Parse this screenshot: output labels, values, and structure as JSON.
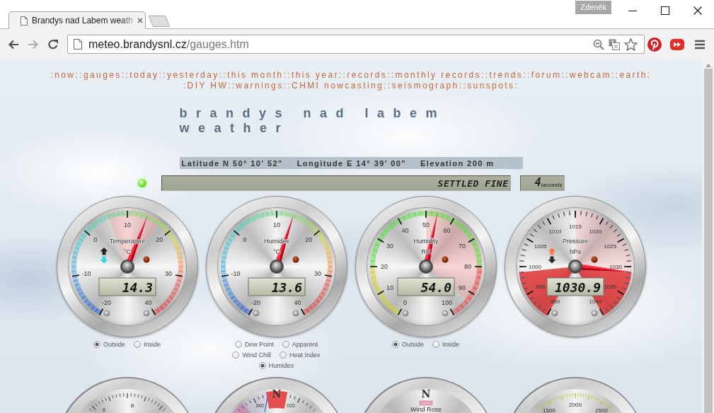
{
  "browser": {
    "tabs": [
      {
        "title": "Brandys nad Labem weath",
        "selected": true
      }
    ],
    "profile": "Zdeněk",
    "url": {
      "host": "meteo.brandysnl.cz",
      "path": "/gauges.htm"
    }
  },
  "nav": [
    [
      ":now:",
      ":gauges:",
      ":today:",
      ":yesterday:",
      ":this month:",
      ":this year:",
      ":records:",
      ":monthly records:",
      ":trends:",
      ":forum:",
      ":webcam:",
      ":earth:"
    ],
    [
      ":DIY HW:",
      ":warnings:",
      ":CHMI nowcasting:",
      ":seismograph:",
      ":sunspots:"
    ]
  ],
  "site_title": [
    "brandys nad labem",
    "weather"
  ],
  "location": [
    "Latitude N 50° 10' 52\"",
    "Longitude E 14° 39' 00\"",
    "Elevation 200 m"
  ],
  "status": {
    "led_on": true,
    "forecast": "SETTLED FINE",
    "countdown": "4",
    "countdown_unit": "seconds"
  },
  "gauges": [
    {
      "kind": "temperature",
      "title": "Temperature",
      "unit": "°C",
      "labels": [
        "-20",
        "-10",
        "0",
        "10",
        "20",
        "30",
        "40"
      ],
      "value": "14.3",
      "needle": {
        "level": 0.572
      },
      "rising": false,
      "options": [
        [
          {
            "label": "Outside",
            "selected": true
          },
          {
            "label": "Inside",
            "selected": false
          }
        ]
      ]
    },
    {
      "kind": "humidex",
      "title": "Humidex",
      "unit": "°C",
      "labels": [
        "-20",
        "-10",
        "0",
        "10",
        "20",
        "30",
        "40"
      ],
      "value": "13.6",
      "needle": {
        "level": 0.56
      },
      "options": [
        [
          {
            "label": "Dew Point",
            "selected": false
          },
          {
            "label": "Apparent",
            "selected": false
          }
        ],
        [
          {
            "label": "Wind Chill",
            "selected": false
          },
          {
            "label": "Heat Index",
            "selected": false
          }
        ],
        [
          {
            "label": "Humidex",
            "selected": true
          }
        ]
      ]
    },
    {
      "kind": "humidity",
      "title": "Humidity",
      "unit": "RH",
      "labels": [
        "0",
        "10",
        "20",
        "30",
        "40",
        "50",
        "60",
        "70",
        "80",
        "90",
        "100"
      ],
      "value": "54.0",
      "needle": {
        "level": 0.54
      },
      "options": [
        [
          {
            "label": "Outside",
            "selected": true
          },
          {
            "label": "Inside",
            "selected": false
          }
        ]
      ]
    },
    {
      "kind": "pressure",
      "title": "Pressure",
      "unit": "hPa",
      "labels": [
        "990",
        "995",
        "1000",
        "1005",
        "1010",
        "1015",
        "1020",
        "1025",
        "1030",
        "1035",
        "1040"
      ],
      "value": "1030.9",
      "needle": {
        "level": 0.818
      },
      "rising": true
    }
  ],
  "lower_gauges": [
    {
      "kind": "wind_speed",
      "labels": [
        "6",
        "8"
      ]
    },
    {
      "kind": "wind_direction",
      "cardinal": "N",
      "labels": [
        "340",
        "020"
      ]
    },
    {
      "kind": "wind_rose",
      "cardinal": "N",
      "title": "Wind Rose"
    },
    {
      "kind": "solar",
      "labels": [
        "1500",
        "2000",
        "2500"
      ]
    }
  ]
}
